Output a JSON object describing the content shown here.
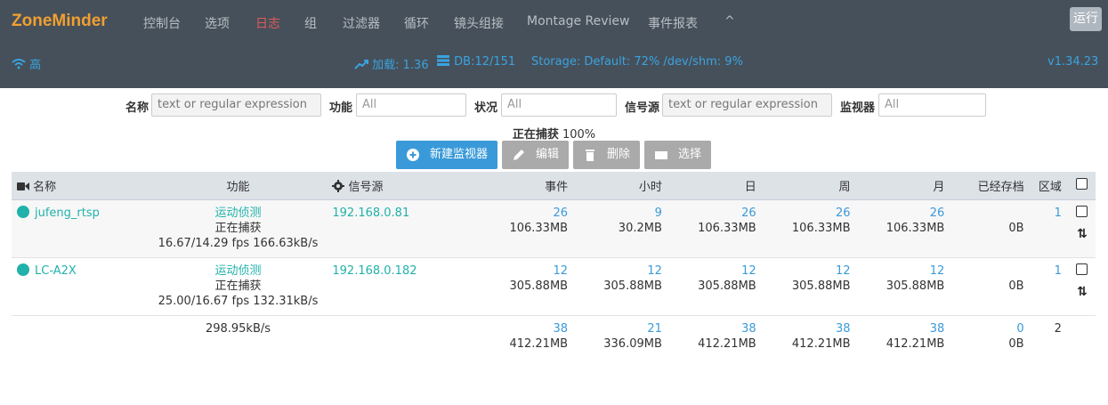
{
  "brand": "ZoneMinder",
  "nav": [
    "控制台",
    "选项",
    "日志",
    "组",
    "过滤器",
    "循环",
    "镜头组接",
    "Montage Review",
    "事件报表",
    "^"
  ],
  "run_label": "运行",
  "status": {
    "wifi": "高",
    "load": "加载: 1.36",
    "db": "DB:12/151",
    "storage": "Storage: Default: 72% /dev/shm: 9%",
    "version": "v1.34.23"
  },
  "filters": {
    "name_label": "名称",
    "name_placeholder": "text or regular expression",
    "function_label": "功能",
    "function_placeholder": "All",
    "status_label": "状况",
    "status_placeholder": "All",
    "source_label": "信号源",
    "source_placeholder": "text or regular expression",
    "monitor_label": "监视器",
    "monitor_placeholder": "All"
  },
  "capture": {
    "label": "正在捕获",
    "value": "100%"
  },
  "buttons": {
    "new": "新建监视器",
    "edit": "编辑",
    "delete": "删除",
    "select": "选择"
  },
  "headers": {
    "name": "名称",
    "function": "功能",
    "source": "信号源",
    "events": "事件",
    "hour": "小时",
    "day": "日",
    "week": "周",
    "month": "月",
    "archived": "已经存档",
    "zones": "区域"
  },
  "rows": [
    {
      "name": "jufeng_rtsp",
      "function": "运动侦测",
      "state": "正在捕获",
      "fps": "16.67/14.29 fps 166.63kB/s",
      "source": "192.168.0.81",
      "events": "26",
      "events_size": "106.33MB",
      "hour": "9",
      "hour_size": "30.2MB",
      "day": "26",
      "day_size": "106.33MB",
      "week": "26",
      "week_size": "106.33MB",
      "month": "26",
      "month_size": "106.33MB",
      "archived": "0B",
      "zones": "1"
    },
    {
      "name": "LC-A2X",
      "function": "运动侦测",
      "state": "正在捕获",
      "fps": "25.00/16.67 fps 132.31kB/s",
      "source": "192.168.0.182",
      "events": "12",
      "events_size": "305.88MB",
      "hour": "12",
      "hour_size": "305.88MB",
      "day": "12",
      "day_size": "305.88MB",
      "week": "12",
      "week_size": "305.88MB",
      "month": "12",
      "month_size": "305.88MB",
      "archived": "0B",
      "zones": "1"
    }
  ],
  "totals": {
    "bandwidth": "298.95kB/s",
    "events": "38",
    "events_size": "412.21MB",
    "hour": "21",
    "hour_size": "336.09MB",
    "day": "38",
    "day_size": "412.21MB",
    "week": "38",
    "week_size": "412.21MB",
    "month": "38",
    "month_size": "412.21MB",
    "archived": "0",
    "archived_size": "0B",
    "zones": "2"
  },
  "colors": {
    "topbar": "#46505a",
    "brand": "#f0a030",
    "accent": "#3a9ad9",
    "teal": "#20b2aa",
    "active_nav": "#e05a5a"
  },
  "icons": {
    "wifi": "wifi-icon",
    "load": "trend-up-icon",
    "db": "database-icon",
    "camera": "camera-icon",
    "gear": "gear-icon",
    "plus": "plus-circle-icon",
    "pencil": "pencil-icon",
    "trash": "trash-icon",
    "select": "select-icon",
    "sort": "sort-arrows-icon",
    "status": "status-dot-icon"
  }
}
